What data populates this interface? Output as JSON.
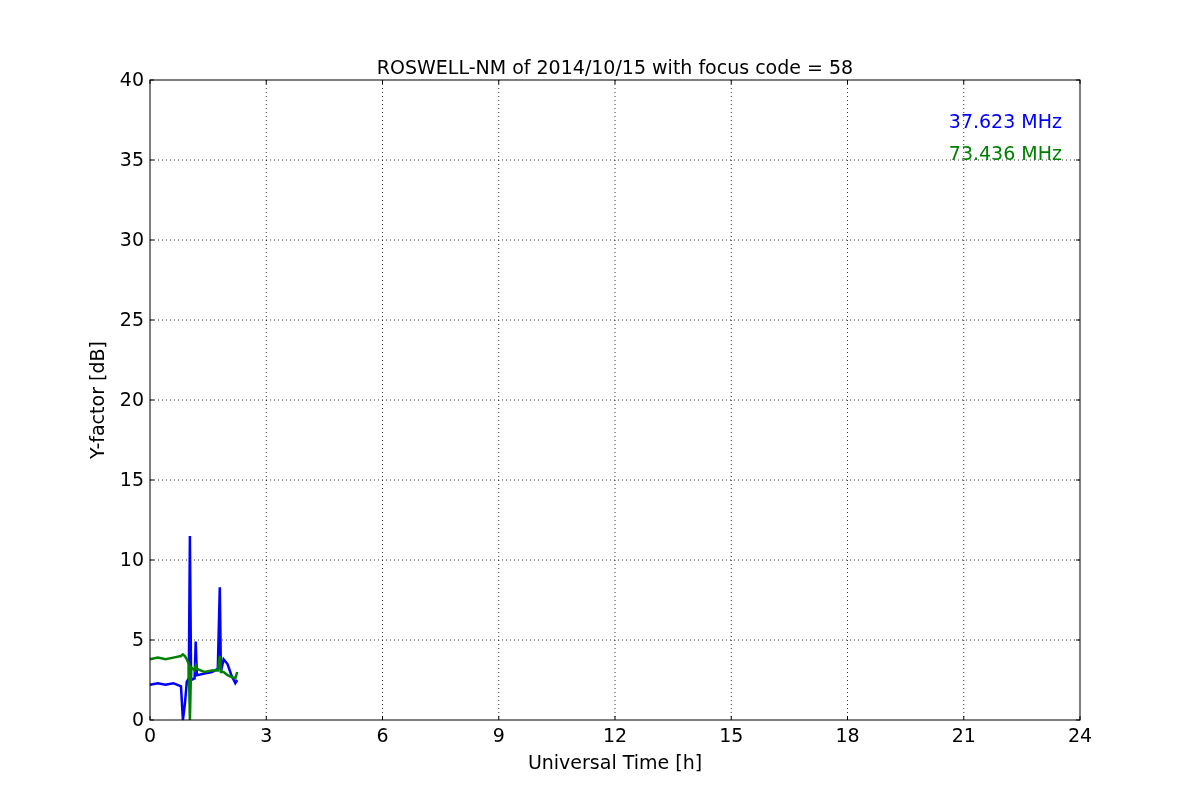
{
  "chart_data": {
    "type": "line",
    "title": "ROSWELL-NM of 2014/10/15 with focus code = 58",
    "xlabel": "Universal Time [h]",
    "ylabel": "Y-factor [dB]",
    "x": [
      0,
      0.2,
      0.4,
      0.6,
      0.8,
      0.85,
      0.9,
      0.95,
      1.0,
      1.03,
      1.06,
      1.15,
      1.18,
      1.21,
      1.4,
      1.6,
      1.75,
      1.8,
      1.83,
      1.9,
      2.0,
      2.1,
      2.2,
      2.25
    ],
    "series": [
      {
        "name": "37.623 MHz",
        "color": "#0000ff",
        "values": [
          2.2,
          2.3,
          2.2,
          2.3,
          2.1,
          0,
          1.0,
          2.4,
          2.6,
          11.5,
          2.5,
          2.6,
          4.9,
          2.8,
          2.9,
          3.0,
          3.2,
          8.3,
          3.0,
          3.8,
          3.5,
          2.8,
          2.3,
          2.5
        ]
      },
      {
        "name": "73.436 MHz",
        "color": "#008000",
        "values": [
          3.8,
          3.9,
          3.8,
          3.9,
          4.0,
          4.1,
          4.0,
          3.8,
          3.5,
          0,
          3.3,
          3.1,
          3.4,
          3.2,
          3.0,
          3.1,
          3.1,
          4.0,
          3.0,
          3.0,
          2.8,
          2.7,
          2.6,
          3.0
        ]
      }
    ],
    "grid": true,
    "xlim": [
      0,
      24
    ],
    "ylim": [
      0,
      40
    ],
    "xticks": [
      0,
      3,
      6,
      9,
      12,
      15,
      18,
      21,
      24
    ],
    "yticks": [
      0,
      5,
      10,
      15,
      20,
      25,
      30,
      35,
      40
    ]
  }
}
